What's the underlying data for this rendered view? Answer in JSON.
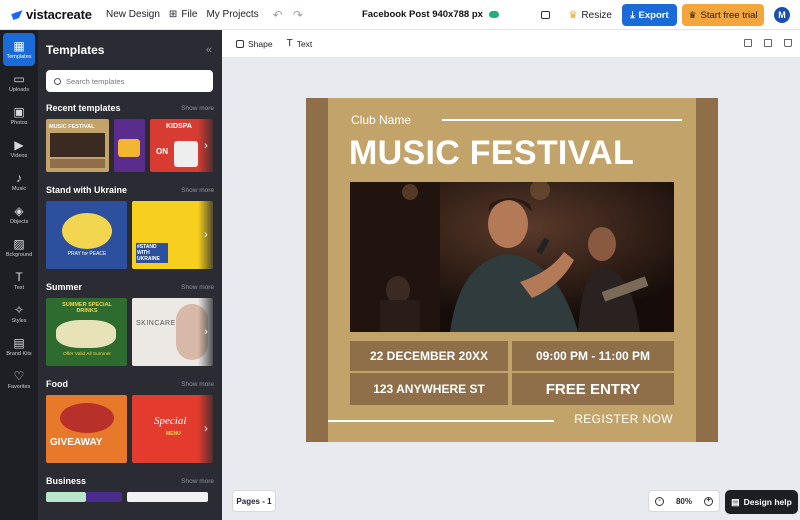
{
  "app": {
    "logo": "vistacreate"
  },
  "topbar": {
    "new_design": "New Design",
    "file": "File",
    "my_projects": "My Projects",
    "doc_title": "Facebook Post 940x788 px",
    "resize": "Resize",
    "export": "Export",
    "trial": "Start free trial",
    "avatar_initial": "M"
  },
  "rail": {
    "items": [
      {
        "label": "Templates",
        "icon": "templates-icon"
      },
      {
        "label": "Uploads",
        "icon": "folder-icon"
      },
      {
        "label": "Photos",
        "icon": "photos-icon"
      },
      {
        "label": "Videos",
        "icon": "video-icon"
      },
      {
        "label": "Music",
        "icon": "music-icon"
      },
      {
        "label": "Objects",
        "icon": "objects-icon"
      },
      {
        "label": "Bckground",
        "icon": "background-icon"
      },
      {
        "label": "Text",
        "icon": "text-icon"
      },
      {
        "label": "Styles",
        "icon": "styles-icon"
      },
      {
        "label": "Brand Kits",
        "icon": "brand-kits-icon"
      },
      {
        "label": "Favorites",
        "icon": "heart-icon"
      }
    ]
  },
  "panel": {
    "title": "Templates",
    "search_placeholder": "Search templates",
    "show_more": "Show more",
    "sections": [
      {
        "title": "Recent templates"
      },
      {
        "title": "Stand with Ukraine"
      },
      {
        "title": "Summer"
      },
      {
        "title": "Food"
      },
      {
        "title": "Business"
      }
    ],
    "thumb_text": {
      "music_festival": "MUSIC FESTIVAL",
      "kidspa": "KIDSPA",
      "on": "ON",
      "pray": "PRAY for PEACE",
      "stand": "#STAND WITH UKRAINE",
      "summer_drinks": "SUMMER SPECIAL DRINKS",
      "offer": "Offer Valid All Summer",
      "skincare": "SKINCARE",
      "giveaway": "GIVEAWAY",
      "special": "Special",
      "menu": "MENU"
    }
  },
  "toolbar": {
    "shape": "Shape",
    "text": "Text"
  },
  "poster": {
    "club_name": "Club Name",
    "headline": "MUSIC FESTIVAL",
    "date": "22 DECEMBER 20XX",
    "time": "09:00 PM - 11:00 PM",
    "address": "123 ANYWHERE ST",
    "entry": "FREE ENTRY",
    "register": "REGISTER NOW"
  },
  "bottom": {
    "pages": "Pages - 1",
    "zoom": "80%",
    "design_help": "Design help"
  },
  "colors": {
    "accent": "#1a6bd8",
    "poster_bg": "#c2a36a",
    "poster_dark": "#8e6f49",
    "trial": "#f4a63d"
  }
}
